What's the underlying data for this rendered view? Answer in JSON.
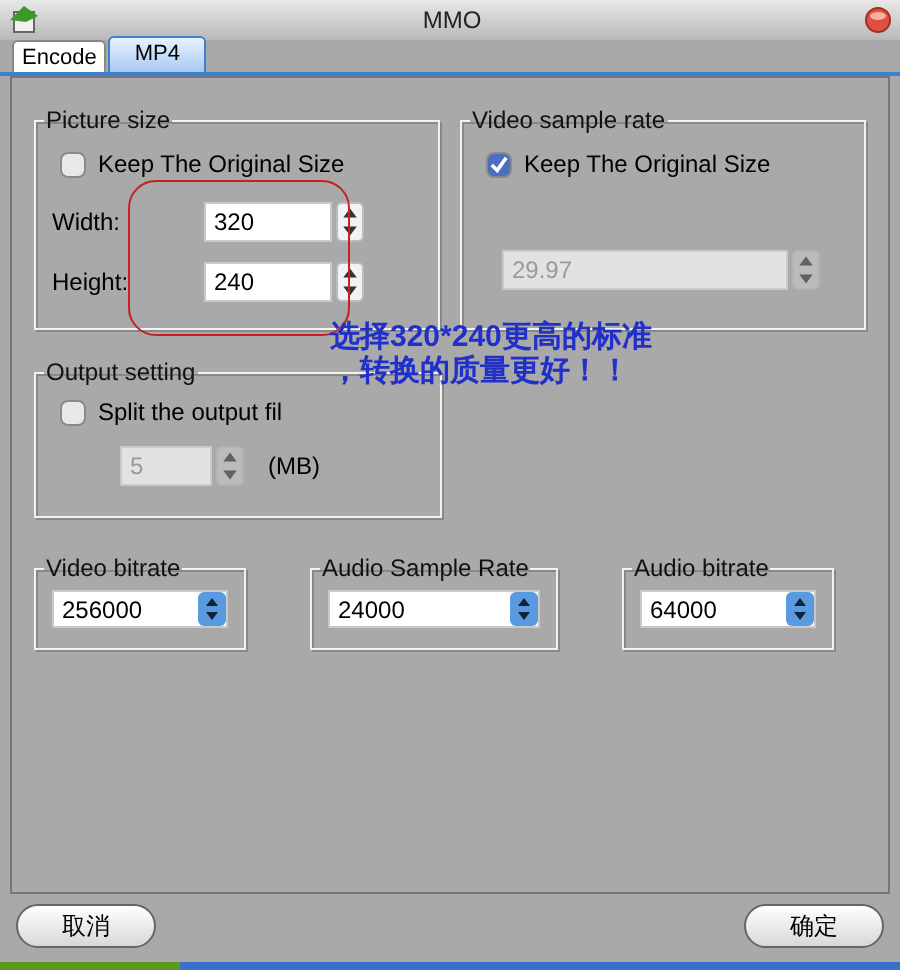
{
  "window": {
    "title": "MMO"
  },
  "tabs": [
    {
      "label": "Encode",
      "selected": false
    },
    {
      "label": "MP4",
      "selected": true
    }
  ],
  "picture_size": {
    "title": "Picture size",
    "keep_original": {
      "label": "Keep The Original Size",
      "checked": false
    },
    "width": {
      "label": "Width:",
      "value": "320"
    },
    "height": {
      "label": "Height:",
      "value": "240"
    }
  },
  "video_sample_rate": {
    "title": "Video sample rate",
    "keep_original": {
      "label": "Keep The Original Size",
      "checked": true
    },
    "rate": {
      "value": "29.97",
      "disabled": true
    }
  },
  "output_setting": {
    "title": "Output setting",
    "split": {
      "label": "Split the output fil",
      "checked": false
    },
    "size": {
      "value": "5",
      "disabled": true
    },
    "unit": "(MB)"
  },
  "dropdowns": [
    {
      "title": "Video bitrate",
      "value": "256000"
    },
    {
      "title": "Audio Sample Rate",
      "value": "24000"
    },
    {
      "title": "Audio bitrate",
      "value": "64000"
    }
  ],
  "annotation": {
    "lines": [
      "选择320*240更高的标准",
      "，转换的质量更好！！"
    ]
  },
  "buttons": [
    {
      "label": "取消"
    },
    {
      "label": "确定"
    }
  ]
}
